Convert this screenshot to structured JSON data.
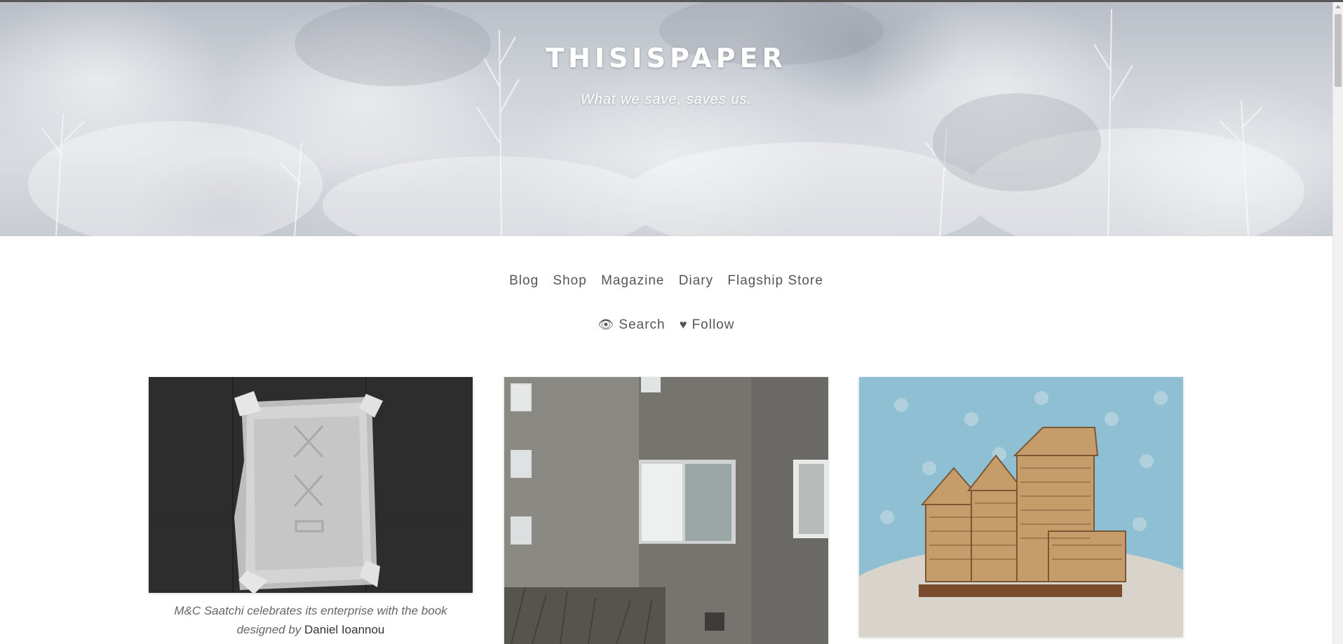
{
  "site": {
    "title": "THISISPAPER",
    "tagline": "What we save, saves us."
  },
  "nav": {
    "primary": [
      {
        "label": "Blog"
      },
      {
        "label": "Shop"
      },
      {
        "label": "Magazine"
      },
      {
        "label": "Diary"
      },
      {
        "label": "Flagship Store"
      }
    ],
    "search_icon": "eye-icon",
    "search_label": "Search",
    "follow_icon": "heart-icon",
    "follow_label": "Follow"
  },
  "posts": [
    {
      "image": "silver-foil-wrapped-book",
      "caption_text": "M&C Saatchi celebrates its enterprise with the book designed by",
      "caption_author": "Daniel Ioannou"
    },
    {
      "image": "grey-apartment-building-corner"
    },
    {
      "image": "matchstick-house-sculpture"
    }
  ],
  "colors": {
    "text": "#555555",
    "background": "#ffffff",
    "hero_overlay_text": "#ffffff"
  }
}
